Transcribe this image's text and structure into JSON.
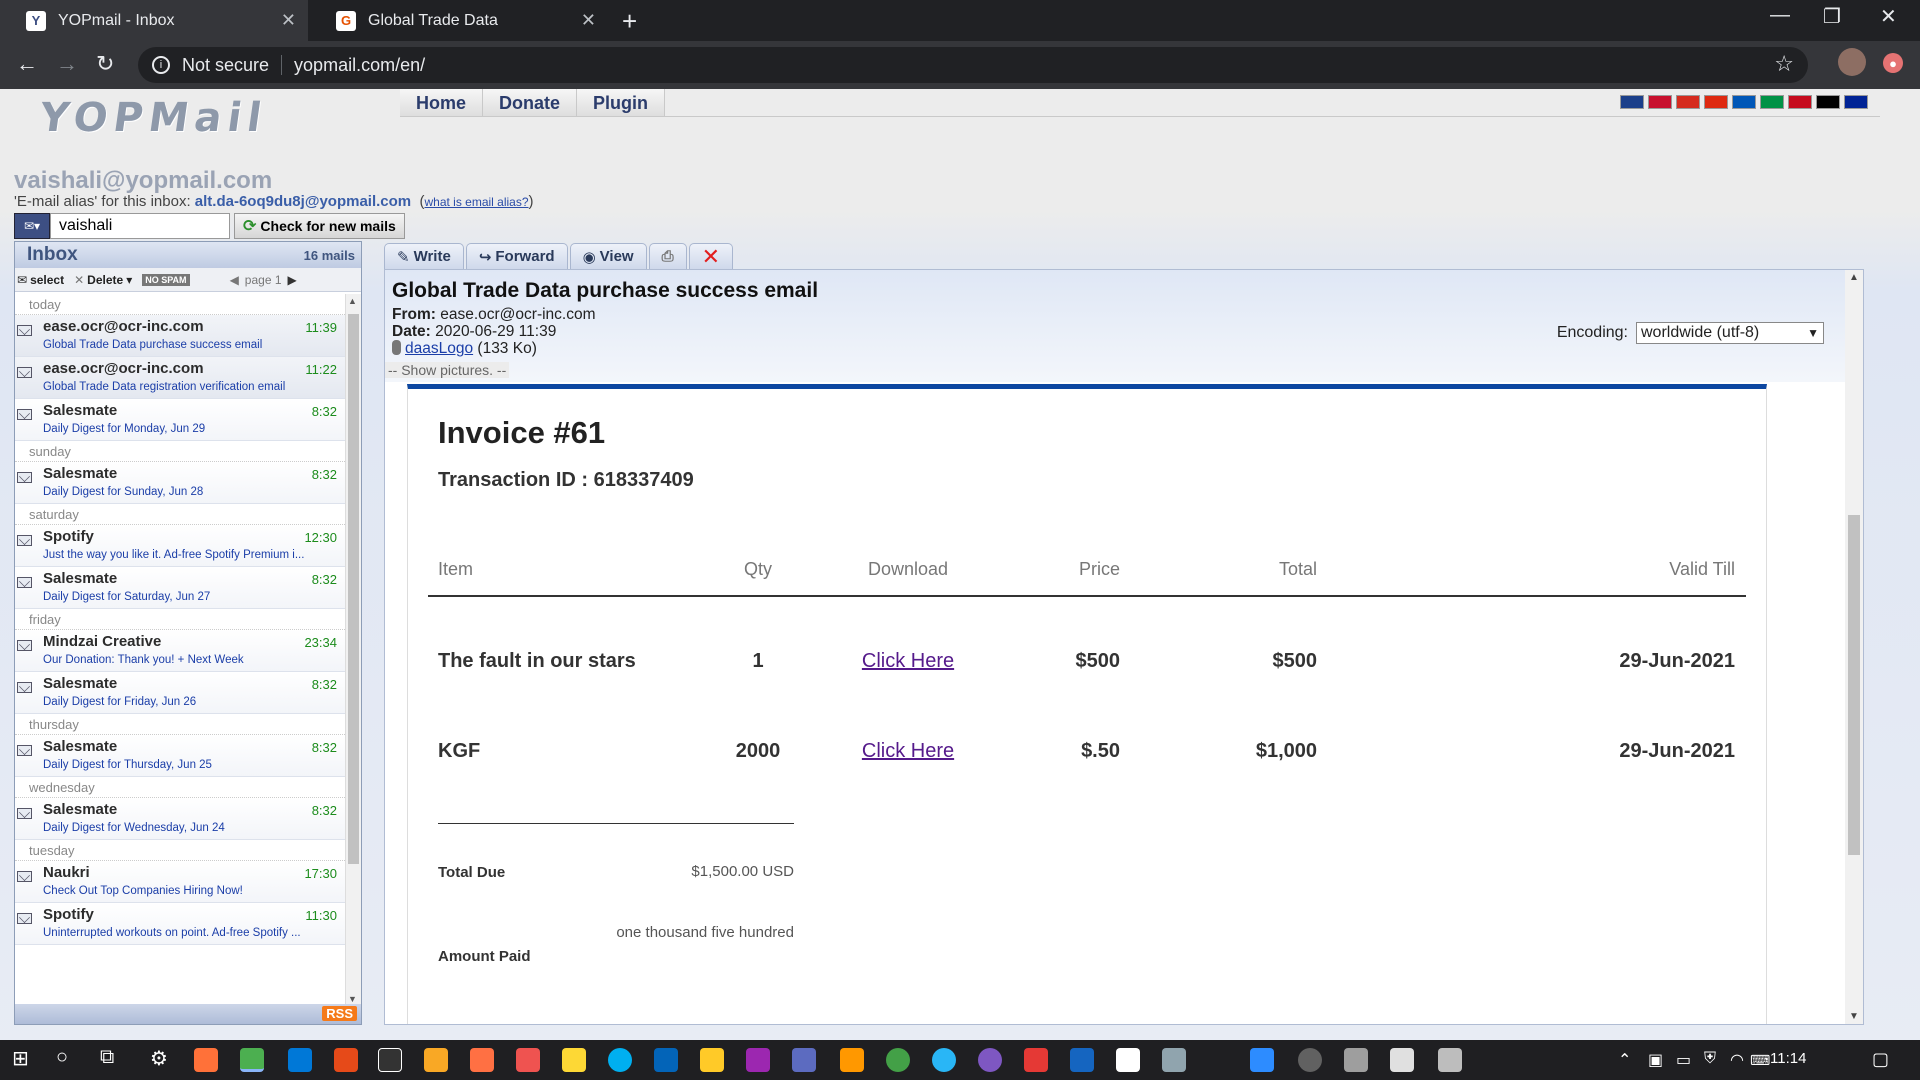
{
  "browser": {
    "tabs": [
      {
        "title": "YOPmail - Inbox",
        "favicon": "Y",
        "color": "#3d4f83"
      },
      {
        "title": "Global Trade Data",
        "favicon": "G",
        "color": "#e65100"
      }
    ],
    "url_security": "Not secure",
    "url": "yopmail.com/en/"
  },
  "site": {
    "logo": "YOPMail",
    "nav": [
      "Home",
      "Donate",
      "Plugin"
    ],
    "flag_colors": [
      "#1b3f8a",
      "#c8102e",
      "#d52b1e",
      "#de2910",
      "#0057b7",
      "#009246",
      "#c60b1e",
      "#000000",
      "#002395"
    ],
    "inbox_email": "vaishali@yopmail.com",
    "alias_prefix": "'E-mail alias' for this inbox:",
    "alias": "alt.da-6oq9du8j@yopmail.com",
    "alias_help": "what is email alias?",
    "login_value": "vaishali",
    "check_label": "Check for new mails"
  },
  "inbox": {
    "title": "Inbox",
    "count": "16 mails",
    "toolbar": {
      "select": "select",
      "delete": "Delete",
      "nospam": "NO SPAM",
      "page": "page 1"
    },
    "groups": [
      {
        "day": "today",
        "mails": [
          {
            "from": "ease.ocr@ocr-inc.com",
            "time": "11:39",
            "subject": "Global Trade Data purchase success email"
          },
          {
            "from": "ease.ocr@ocr-inc.com",
            "time": "11:22",
            "subject": "Global Trade Data registration verification email"
          },
          {
            "from": "Salesmate",
            "time": "8:32",
            "subject": "Daily Digest for Monday, Jun 29"
          }
        ]
      },
      {
        "day": "sunday",
        "mails": [
          {
            "from": "Salesmate",
            "time": "8:32",
            "subject": "Daily Digest for Sunday, Jun 28"
          }
        ]
      },
      {
        "day": "saturday",
        "mails": [
          {
            "from": "Spotify",
            "time": "12:30",
            "subject": "Just the way you like it. Ad-free Spotify Premium i..."
          },
          {
            "from": "Salesmate",
            "time": "8:32",
            "subject": "Daily Digest for Saturday, Jun 27"
          }
        ]
      },
      {
        "day": "friday",
        "mails": [
          {
            "from": "Mindzai Creative",
            "time": "23:34",
            "subject": "Our Donation: Thank you! + Next Week"
          },
          {
            "from": "Salesmate",
            "time": "8:32",
            "subject": "Daily Digest for Friday, Jun 26"
          }
        ]
      },
      {
        "day": "thursday",
        "mails": [
          {
            "from": "Salesmate",
            "time": "8:32",
            "subject": "Daily Digest for Thursday, Jun 25"
          }
        ]
      },
      {
        "day": "wednesday",
        "mails": [
          {
            "from": "Salesmate",
            "time": "8:32",
            "subject": "Daily Digest for Wednesday, Jun 24"
          }
        ]
      },
      {
        "day": "tuesday",
        "mails": [
          {
            "from": "Naukri",
            "time": "17:30",
            "subject": "Check Out Top Companies Hiring Now!"
          },
          {
            "from": "Spotify",
            "time": "11:30",
            "subject": "Uninterrupted workouts on point. Ad-free Spotify ..."
          }
        ]
      }
    ],
    "rss": "RSS"
  },
  "mail": {
    "tabs": {
      "write": "Write",
      "forward": "Forward",
      "view": "View"
    },
    "subject": "Global Trade Data purchase success email",
    "from_label": "From:",
    "from": "ease.ocr@ocr-inc.com",
    "date_label": "Date:",
    "date": "2020-06-29 11:39",
    "attachment": "daasLogo",
    "attachment_size": "(133 Ko)",
    "show_pictures": "-- Show pictures. --",
    "encoding_label": "Encoding:",
    "encoding_value": "worldwide (utf-8)"
  },
  "invoice": {
    "title": "Invoice #61",
    "transaction": "Transaction ID : 618337409",
    "headers": [
      "Item",
      "Qty",
      "Download",
      "Price",
      "Total",
      "Valid Till"
    ],
    "rows": [
      {
        "item": "The fault in our stars",
        "qty": "1",
        "download": "Click Here",
        "price": "$500",
        "total": "$500",
        "valid": "29-Jun-2021"
      },
      {
        "item": "KGF",
        "qty": "2000",
        "download": "Click Here",
        "price": "$.50",
        "total": "$1,000",
        "valid": "29-Jun-2021"
      }
    ],
    "total_due_label": "Total Due",
    "total_due": "$1,500.00 USD",
    "amount_paid_label": "Amount Paid",
    "amount_paid": "one thousand five hundred"
  },
  "taskbar": {
    "time": "11:14"
  }
}
